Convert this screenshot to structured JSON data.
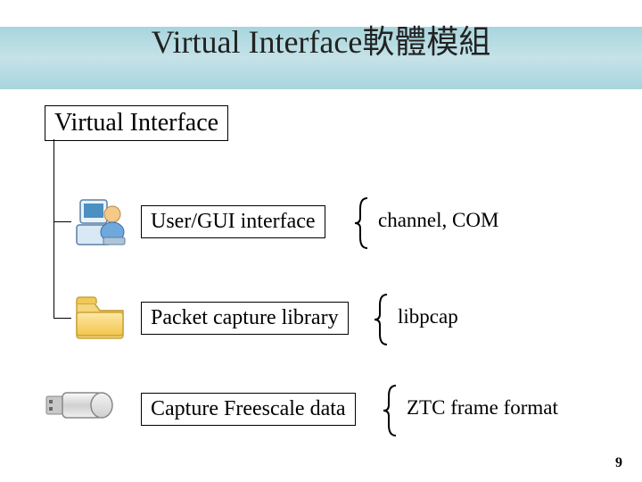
{
  "title": "Virtual Interface軟體模組",
  "root": "Virtual Interface",
  "rows": [
    {
      "label": "User/GUI interface",
      "detail": "channel, COM",
      "icon": "user-gui-icon"
    },
    {
      "label": "Packet capture library",
      "detail": "libpcap",
      "icon": "folder-icon"
    },
    {
      "label": "Capture Freescale data",
      "detail": "ZTC frame format",
      "icon": "usb-icon"
    }
  ],
  "page_number": "9"
}
